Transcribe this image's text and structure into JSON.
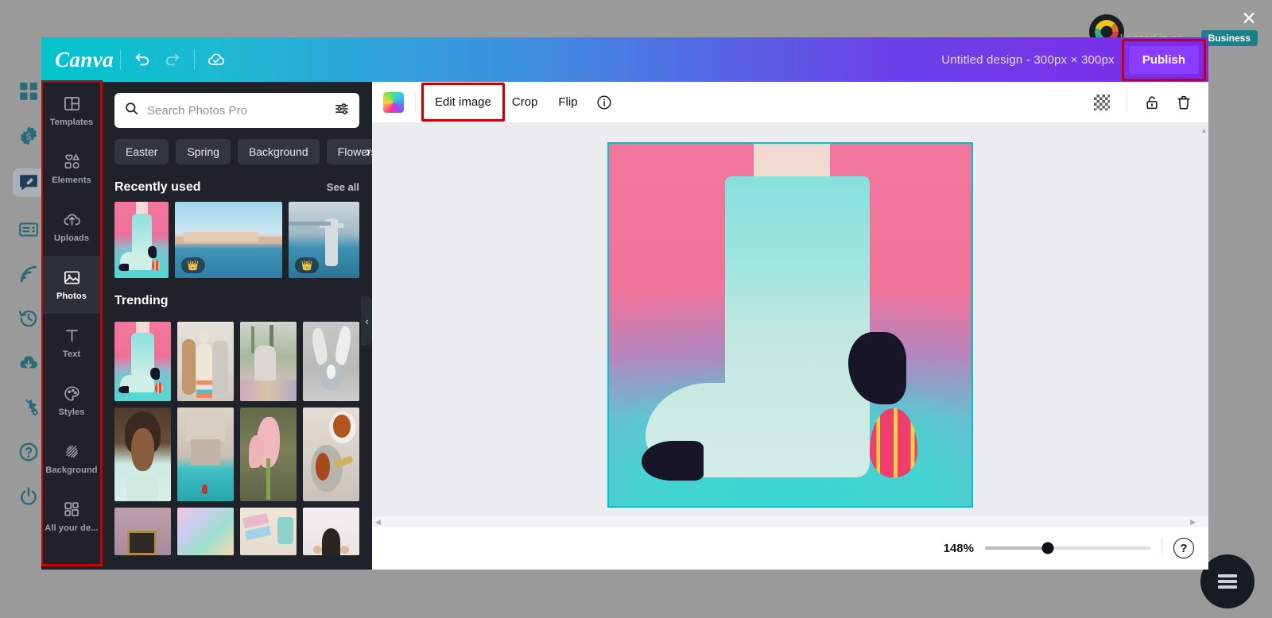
{
  "host": {
    "close_label": "✕",
    "username": "Logged in as",
    "badge": "Business",
    "fab_icon": "menu-icon",
    "rail_icons": [
      "grid-icon",
      "coin-badge-icon",
      "edit-bubble-icon",
      "card-icon",
      "rss-icon",
      "history-icon",
      "cloud-download-icon",
      "settings-gears-icon",
      "help-circle-icon",
      "power-icon"
    ]
  },
  "topbar": {
    "logo": "Canva",
    "undo_icon": "undo-icon",
    "redo_icon": "redo-icon",
    "saved_icon": "cloud-check-icon",
    "doc_title": "Untitled design - 300px × 300px",
    "publish_label": "Publish"
  },
  "sidebar": {
    "items": [
      {
        "label": "Templates",
        "icon": "templates-icon",
        "active": false
      },
      {
        "label": "Elements",
        "icon": "elements-icon",
        "active": false
      },
      {
        "label": "Uploads",
        "icon": "uploads-icon",
        "active": false
      },
      {
        "label": "Photos",
        "icon": "photos-icon",
        "active": true
      },
      {
        "label": "Text",
        "icon": "text-icon",
        "active": false
      },
      {
        "label": "Styles",
        "icon": "styles-icon",
        "active": false
      },
      {
        "label": "Background",
        "icon": "background-icon",
        "active": false
      },
      {
        "label": "All your de...",
        "icon": "all-designs-icon",
        "active": false
      }
    ]
  },
  "panel": {
    "search": {
      "placeholder": "Search Photos Pro",
      "value": "",
      "icon": "search-icon",
      "filter_icon": "filter-sliders-icon"
    },
    "chips": [
      "Easter",
      "Spring",
      "Background",
      "Flowers"
    ],
    "chips_next_icon": "chevron-right-icon",
    "recent": {
      "title": "Recently used",
      "see_all": "See all",
      "next_icon": "chevron-right-icon"
    },
    "trending": {
      "title": "Trending"
    }
  },
  "context_toolbar": {
    "swatch_icon": "image-color-swatch",
    "edit_image_label": "Edit image",
    "crop_label": "Crop",
    "flip_label": "Flip",
    "info_icon": "info-icon",
    "transparency_icon": "transparency-checker-icon",
    "lock_icon": "unlocked-padlock-icon",
    "delete_icon": "trash-icon"
  },
  "canvas": {
    "selected_image": "sock-and-easter-egg-photo",
    "selection_color": "#00c4cc"
  },
  "zoombar": {
    "zoom_level": "148%",
    "slider_percent": 38,
    "help_label": "?"
  },
  "annotations": {
    "color": "#c80000",
    "targets": [
      "sidebar",
      "edit-image-button",
      "publish-button"
    ]
  }
}
